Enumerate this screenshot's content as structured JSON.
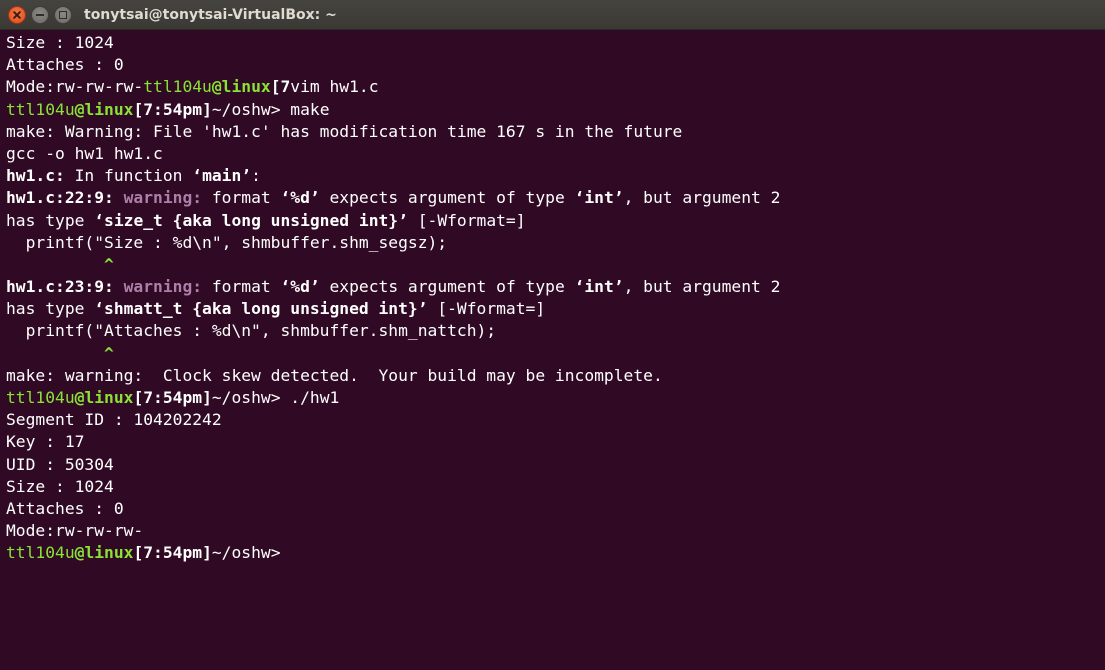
{
  "window": {
    "title": "tonytsai@tonytsai-VirtualBox: ~"
  },
  "terminal": {
    "lines": [
      [
        {
          "t": "Size : 1024"
        }
      ],
      [
        {
          "t": "Attaches : 0"
        }
      ],
      [
        {
          "t": "Mode:rw-rw-rw-"
        },
        {
          "t": "ttl104u",
          "c": "g"
        },
        {
          "t": "@",
          "c": "g b"
        },
        {
          "t": "linux",
          "c": "g b"
        },
        {
          "t": "[7",
          "c": "b"
        },
        {
          "t": "vim hw1.c"
        }
      ],
      [
        {
          "t": "ttl104u",
          "c": "g"
        },
        {
          "t": "@",
          "c": "g b"
        },
        {
          "t": "linux",
          "c": "g b"
        },
        {
          "t": "[7:54pm]",
          "c": "b"
        },
        {
          "t": "~/oshw> make"
        }
      ],
      [
        {
          "t": "make: Warning: File 'hw1.c' has modification time 167 s in the future"
        }
      ],
      [
        {
          "t": "gcc -o hw1 hw1.c"
        }
      ],
      [
        {
          "t": "hw1.c:",
          "c": "b"
        },
        {
          "t": " In function "
        },
        {
          "t": "‘main’",
          "c": "b"
        },
        {
          "t": ":"
        }
      ],
      [
        {
          "t": "hw1.c:22:9:",
          "c": "b"
        },
        {
          "t": " warning:",
          "c": "m b"
        },
        {
          "t": " format "
        },
        {
          "t": "‘%d’",
          "c": "b"
        },
        {
          "t": " expects argument of type "
        },
        {
          "t": "‘int’",
          "c": "b"
        },
        {
          "t": ", but argument 2"
        }
      ],
      [
        {
          "t": "has type "
        },
        {
          "t": "‘size_t {aka long unsigned int}’",
          "c": "b"
        },
        {
          "t": " [-Wformat=]"
        }
      ],
      [
        {
          "t": "  printf(\"Size : %d\\n\", shmbuffer.shm_segsz);"
        }
      ],
      [
        {
          "t": "          "
        },
        {
          "t": "^",
          "c": "caret b"
        }
      ],
      [
        {
          "t": "hw1.c:23:9:",
          "c": "b"
        },
        {
          "t": " warning:",
          "c": "m b"
        },
        {
          "t": " format "
        },
        {
          "t": "‘%d’",
          "c": "b"
        },
        {
          "t": " expects argument of type "
        },
        {
          "t": "‘int’",
          "c": "b"
        },
        {
          "t": ", but argument 2"
        }
      ],
      [
        {
          "t": "has type "
        },
        {
          "t": "‘shmatt_t {aka long unsigned int}’",
          "c": "b"
        },
        {
          "t": " [-Wformat=]"
        }
      ],
      [
        {
          "t": "  printf(\"Attaches : %d\\n\", shmbuffer.shm_nattch);"
        }
      ],
      [
        {
          "t": "          "
        },
        {
          "t": "^",
          "c": "caret b"
        }
      ],
      [
        {
          "t": "make: warning:  Clock skew detected.  Your build may be incomplete."
        }
      ],
      [
        {
          "t": "ttl104u",
          "c": "g"
        },
        {
          "t": "@",
          "c": "g b"
        },
        {
          "t": "linux",
          "c": "g b"
        },
        {
          "t": "[7:54pm]",
          "c": "b"
        },
        {
          "t": "~/oshw> ./hw1"
        }
      ],
      [
        {
          "t": "Segment ID : 104202242"
        }
      ],
      [
        {
          "t": "Key : 17"
        }
      ],
      [
        {
          "t": "UID : 50304"
        }
      ],
      [
        {
          "t": "Size : 1024"
        }
      ],
      [
        {
          "t": "Attaches : 0"
        }
      ],
      [
        {
          "t": "Mode:rw-rw-rw-"
        }
      ],
      [
        {
          "t": "ttl104u",
          "c": "g"
        },
        {
          "t": "@",
          "c": "g b"
        },
        {
          "t": "linux",
          "c": "g b"
        },
        {
          "t": "[7:54pm]",
          "c": "b"
        },
        {
          "t": "~/oshw>"
        }
      ]
    ]
  },
  "colors": {
    "background": "#300a24",
    "prompt_green": "#8ae234",
    "warning_magenta": "#ad7fa8",
    "close_button": "#df4a16"
  },
  "icons": [
    "close-icon",
    "minimize-icon",
    "maximize-icon"
  ]
}
